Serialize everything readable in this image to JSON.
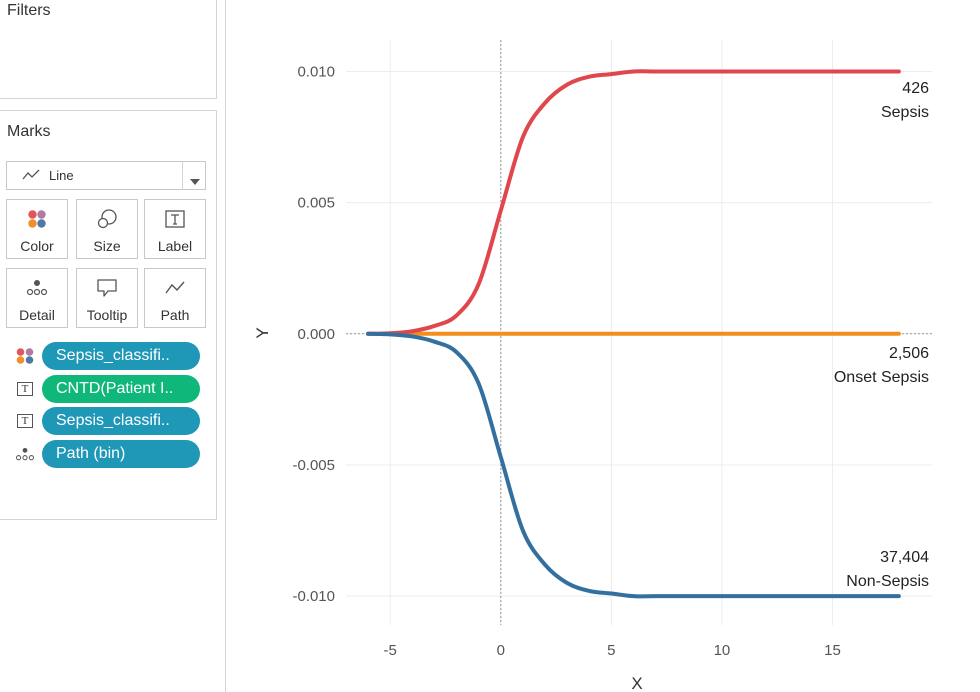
{
  "filters": {
    "title": "Filters"
  },
  "marks": {
    "title": "Marks",
    "mark_type": {
      "label": "Line",
      "icon": "line-chart-icon"
    },
    "buttons": [
      {
        "label": "Color",
        "icon": "color-dots-icon"
      },
      {
        "label": "Size",
        "icon": "size-circles-icon"
      },
      {
        "label": "Label",
        "icon": "text-label-icon"
      },
      {
        "label": "Detail",
        "icon": "detail-dots-icon"
      },
      {
        "label": "Tooltip",
        "icon": "speech-bubble-icon"
      },
      {
        "label": "Path",
        "icon": "path-line-icon"
      }
    ],
    "pills": [
      {
        "text": "Sepsis_classifi..",
        "icon": "color-dots-icon",
        "color": "#1f97b7"
      },
      {
        "text": "CNTD(Patient I..",
        "icon": "text-label-icon",
        "color": "#0fb87a"
      },
      {
        "text": "Sepsis_classifi..",
        "icon": "text-label-icon",
        "color": "#1f97b7"
      },
      {
        "text": "Path (bin)",
        "icon": "detail-dots-icon",
        "color": "#1f97b7"
      }
    ]
  },
  "chart_data": {
    "type": "line",
    "xlabel": "X",
    "ylabel": "Y",
    "xlim": [
      -7,
      19.5
    ],
    "ylim": [
      -0.0111,
      0.0112
    ],
    "x_ticks": [
      -5,
      0,
      5,
      10,
      15
    ],
    "y_ticks": [
      0.01,
      0.005,
      0.0,
      -0.005,
      -0.01
    ],
    "x_tick_labels": [
      "-5",
      "0",
      "5",
      "10",
      "15"
    ],
    "y_tick_labels": [
      "0.010",
      "0.005",
      "0.000",
      "-0.005",
      "-0.010"
    ],
    "grid": true,
    "reference_lines": {
      "x": 0,
      "y": 0
    },
    "series": [
      {
        "name": "Sepsis",
        "label_value": "426",
        "color": "#e0474c",
        "x": [
          -6,
          -5,
          -4,
          -3,
          -2,
          -1,
          0,
          1,
          2,
          3,
          4,
          5,
          6,
          7,
          8,
          10,
          12,
          14,
          16,
          18
        ],
        "y": [
          0.0,
          2e-05,
          0.0001,
          0.0003,
          0.0007,
          0.0019,
          0.0047,
          0.0075,
          0.0088,
          0.0095,
          0.0098,
          0.0099,
          0.01,
          0.01,
          0.01,
          0.01,
          0.01,
          0.01,
          0.01,
          0.01
        ]
      },
      {
        "name": "Onset Sepsis",
        "label_value": "2,506",
        "color": "#f28e1c",
        "x": [
          -6,
          18
        ],
        "y": [
          0.0,
          0.0
        ]
      },
      {
        "name": "Non-Sepsis",
        "label_value": "37,404",
        "color": "#33709f",
        "x": [
          -6,
          -5,
          -4,
          -3,
          -2,
          -1,
          0,
          1,
          2,
          3,
          4,
          5,
          6,
          7,
          8,
          10,
          12,
          14,
          16,
          18
        ],
        "y": [
          0.0,
          -2e-05,
          -0.0001,
          -0.0003,
          -0.0007,
          -0.0019,
          -0.0047,
          -0.0075,
          -0.0088,
          -0.0095,
          -0.0098,
          -0.0099,
          -0.01,
          -0.01,
          -0.01,
          -0.01,
          -0.01,
          -0.01,
          -0.01,
          -0.01
        ]
      }
    ]
  }
}
